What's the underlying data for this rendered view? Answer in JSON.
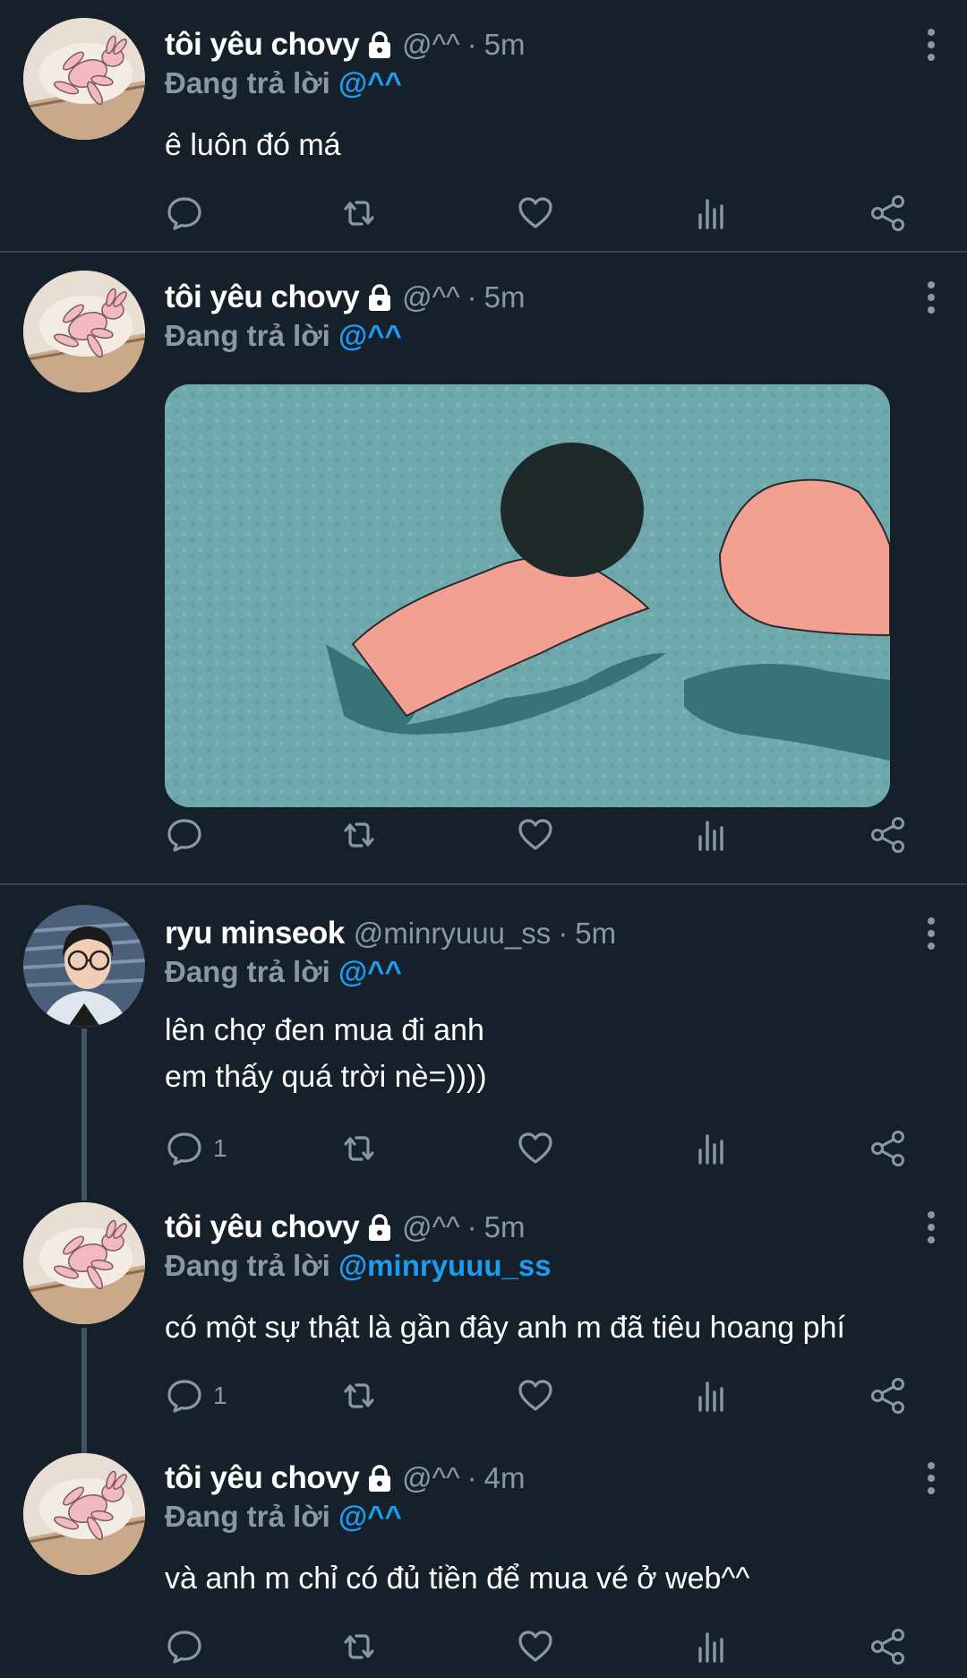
{
  "tweets": [
    {
      "name": "tôi yêu chovy",
      "handle": "@^^",
      "time": "5m",
      "reply_label": "Đang trả lời",
      "reply_to": "@^^",
      "text": "ê luôn đó má",
      "reply_count": ""
    },
    {
      "name": "tôi yêu chovy",
      "handle": "@^^",
      "time": "5m",
      "reply_label": "Đang trả lời",
      "reply_to": "@^^",
      "text": "",
      "reply_count": ""
    },
    {
      "name": "ryu minseok",
      "handle": "@minryuuu_ss",
      "time": "5m",
      "reply_label": "Đang trả lời",
      "reply_to": "@^^",
      "text_line1": "lên chợ đen mua đi anh",
      "text_line2": "em thấy quá trời nè=))))",
      "reply_count": "1"
    },
    {
      "name": "tôi yêu chovy",
      "handle": "@^^",
      "time": "5m",
      "reply_label": "Đang trả lời",
      "reply_to": "@minryuuu_ss",
      "text": "có một sự thật là gần đây anh m đã tiêu hoang phí",
      "reply_count": "1"
    },
    {
      "name": "tôi yêu chovy",
      "handle": "@^^",
      "time": "4m",
      "reply_label": "Đang trả lời",
      "reply_to": "@^^",
      "text": "và anh m chỉ có đủ tiền để mua vé ở web^^",
      "reply_count": ""
    }
  ],
  "separator": "·",
  "icons": {
    "lock": "lock-icon",
    "more": "more-vertical-icon",
    "reply": "reply-icon",
    "retweet": "retweet-icon",
    "like": "heart-icon",
    "analytics": "analytics-icon",
    "share": "share-icon"
  },
  "colors": {
    "background": "#15202b",
    "secondary_text": "#8899a6",
    "mention": "#1d9bf0",
    "divider": "#38444d"
  }
}
